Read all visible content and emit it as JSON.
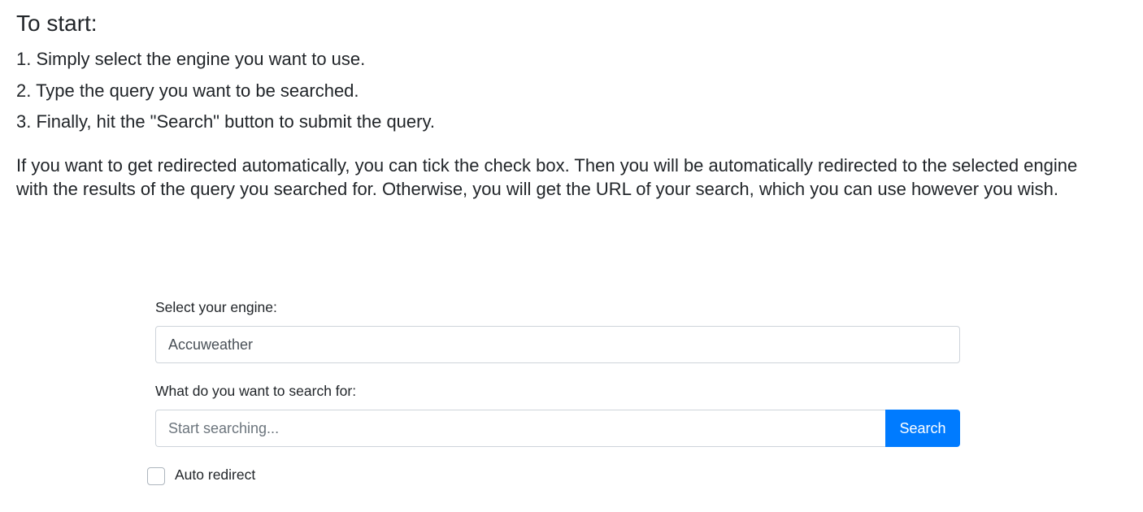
{
  "intro": {
    "heading": "To start:",
    "steps": [
      "1. Simply select the engine you want to use.",
      "2. Type the query you want to be searched.",
      "3. Finally, hit the \"Search\" button to submit the query."
    ],
    "paragraph": "If you want to get redirected automatically, you can tick the check box. Then you will be automatically redirected to the selected engine with the results of the query you searched for. Otherwise, you will get the URL of your search, which you can use however you wish."
  },
  "form": {
    "engine_label": "Select your engine:",
    "engine_value": "Accuweather",
    "query_label": "What do you want to search for:",
    "query_placeholder": "Start searching...",
    "query_value": "",
    "search_button_label": "Search",
    "auto_redirect_label": "Auto redirect",
    "auto_redirect_checked": false
  },
  "colors": {
    "primary": "#007bff",
    "text": "#212529",
    "border": "#ced4da"
  }
}
